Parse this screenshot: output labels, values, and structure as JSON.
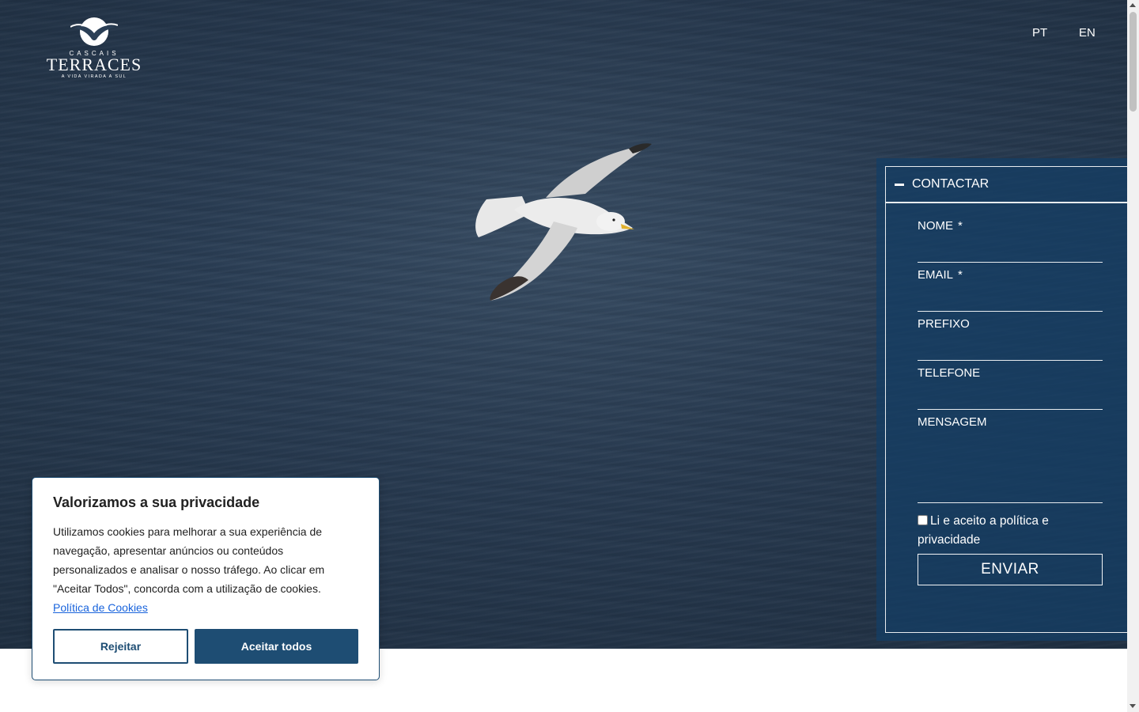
{
  "header": {
    "logo": {
      "small_text": "CASCAIS",
      "main_text": "TERRACES",
      "tagline": "A VIDA VIRADA A SUL",
      "icon": "bird-logo-icon"
    },
    "languages": [
      "PT",
      "EN"
    ]
  },
  "hero": {
    "image_subject": "seagull-icon"
  },
  "contact": {
    "title": "CONTACTAR",
    "toggle_icon": "minus-icon",
    "fields": {
      "name": {
        "label": "NOME",
        "required": "*",
        "value": ""
      },
      "email": {
        "label": "EMAIL",
        "required": "*",
        "value": ""
      },
      "prefix": {
        "label": "PREFIXO",
        "value": ""
      },
      "phone": {
        "label": "TELEFONE",
        "value": ""
      },
      "message": {
        "label": "MENSAGEM",
        "value": ""
      }
    },
    "consent_label": "Li e aceito a política e privacidade",
    "submit_label": "ENVIAR"
  },
  "cookie_banner": {
    "title": "Valorizamos a sua privacidade",
    "text": "Utilizamos cookies para melhorar a sua experiência de navegação, apresentar anúncios ou conteúdos personalizados e analisar o nosso tráfego. Ao clicar em \"Aceitar Todos\", concorda com a utilização de cookies.",
    "link_label": "Política de Cookies",
    "reject_label": "Rejeitar",
    "accept_label": "Aceitar todos"
  },
  "colors": {
    "brand": "#1e4d73",
    "panel": "#143e64",
    "link": "#1863dc",
    "sea": "#2b3f56"
  }
}
